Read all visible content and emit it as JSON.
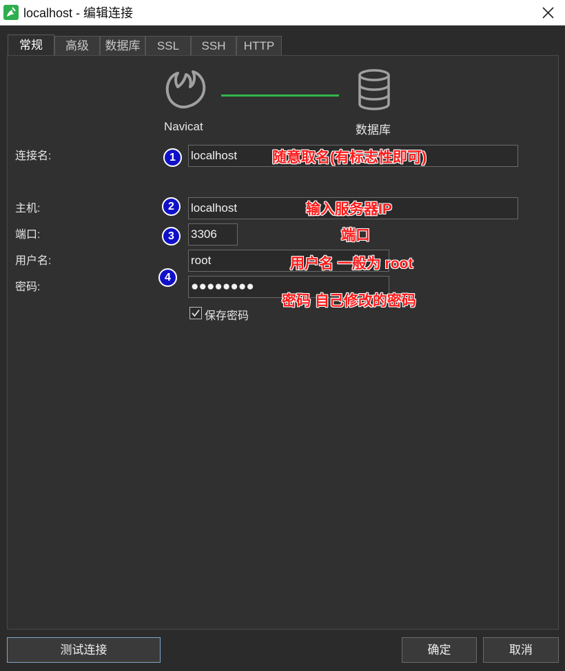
{
  "window": {
    "title": "localhost - 编辑连接",
    "accent": "#2fae4e"
  },
  "tabs": [
    {
      "label": "常规",
      "active": true
    },
    {
      "label": "高级",
      "active": false
    },
    {
      "label": "数据库",
      "active": false
    },
    {
      "label": "SSL",
      "active": false
    },
    {
      "label": "SSH",
      "active": false
    },
    {
      "label": "HTTP",
      "active": false
    }
  ],
  "header": {
    "left_label": "Navicat",
    "right_label": "数据库",
    "left_icon": "navicat-logo-icon",
    "right_icon": "database-icon",
    "line_color": "#33b64a"
  },
  "form": {
    "connection_name": {
      "label": "连接名:",
      "value": "localhost"
    },
    "host": {
      "label": "主机:",
      "value": "localhost"
    },
    "port": {
      "label": "端口:",
      "value": "3306"
    },
    "username": {
      "label": "用户名:",
      "value": "root"
    },
    "password": {
      "label": "密码:",
      "value": "●●●●●●●●"
    },
    "save_password": {
      "label": "保存密码",
      "checked": true
    }
  },
  "annotations": {
    "badges": [
      "1",
      "2",
      "3",
      "4"
    ],
    "notes": [
      "随意取名(有标志性即可)",
      "输入服务器IP",
      "端口",
      "用户名 一般为 root",
      "密码 自己修改的密码"
    ],
    "note_color": "#ff1a1a",
    "badge_color": "#1010c8"
  },
  "buttons": {
    "test": "测试连接",
    "ok": "确定",
    "cancel": "取消"
  }
}
